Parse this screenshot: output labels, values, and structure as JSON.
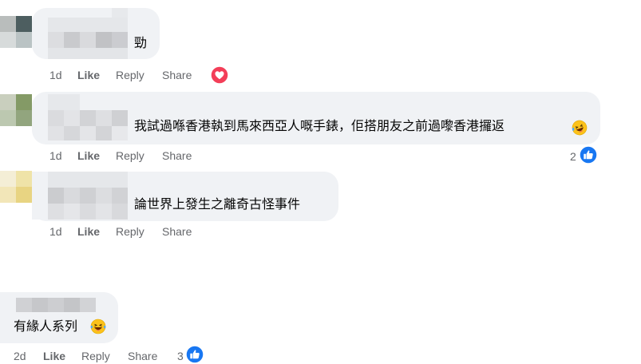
{
  "comments": [
    {
      "text": "勁",
      "actions": {
        "time": "1d",
        "like": "Like",
        "reply": "Reply",
        "share": "Share"
      },
      "reaction_icon": "love-icon"
    },
    {
      "text": "我試過喺香港執到馬來西亞人嘅手錶，佢搭朋友之前過嚟香港攞返",
      "actions": {
        "time": "1d",
        "like": "Like",
        "reply": "Reply",
        "share": "Share"
      },
      "reaction_count": "2",
      "reaction_icon": "like-icon",
      "emoji": "laughing-tears-emoji"
    },
    {
      "text": "論世界上發生之離奇古怪事件",
      "actions": {
        "time": "1d",
        "like": "Like",
        "reply": "Reply",
        "share": "Share"
      }
    },
    {
      "text": "有緣人系列",
      "actions": {
        "time": "2d",
        "like": "Like",
        "reply": "Reply",
        "share": "Share"
      },
      "reaction_count": "3",
      "reaction_icon": "like-icon",
      "emoji": "laughing-tears-emoji"
    }
  ],
  "colors": {
    "bubble": "#f0f2f5",
    "meta": "#65676b",
    "like_blue": "#1877f2",
    "love_red": "#f33e58"
  }
}
